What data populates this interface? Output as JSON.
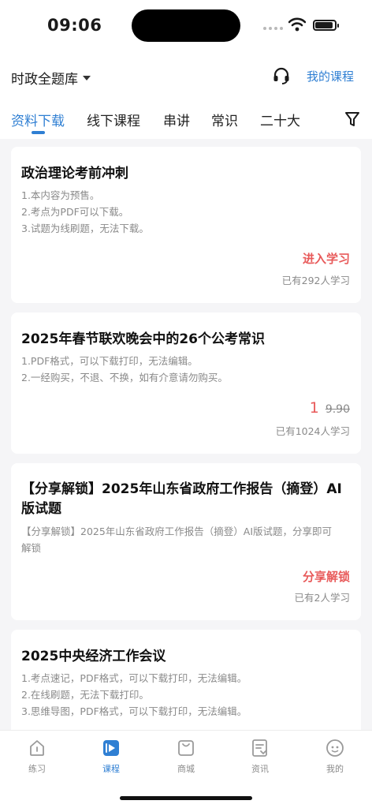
{
  "status_bar": {
    "time": "09:06"
  },
  "header": {
    "bank": "时政全题库",
    "my_course": "我的课程"
  },
  "tabs": [
    {
      "label": "资料下载",
      "active": true
    },
    {
      "label": "线下课程"
    },
    {
      "label": "串讲"
    },
    {
      "label": "常识"
    },
    {
      "label": "二十大"
    }
  ],
  "cards": [
    {
      "title": "政治理论考前冲刺",
      "lines": [
        "1.本内容为预售。",
        "2.考点为PDF可以下载。",
        "3.试题为线刷题，无法下载。"
      ],
      "action": "进入学习",
      "learners": "已有292人学习"
    },
    {
      "title": "2025年春节联欢晚会中的26个公考常识",
      "lines": [
        "1.PDF格式，可以下载打印，无法编辑。",
        "2.一经购买，不退、不换，如有介意请勿购买。"
      ],
      "price": "1",
      "old_price": "9.90",
      "learners": "已有1024人学习"
    },
    {
      "title_line1": "【分享解锁】2025年山东省政府工作报告（摘登）AI",
      "title_line2": "版试题",
      "line1": "【分享解锁】2025年山东省政府工作报告（摘登）AI版试题，分享即可",
      "line2": "解锁",
      "action": "分享解锁",
      "learners": "已有2人学习"
    },
    {
      "title": "2025中央经济工作会议",
      "lines": [
        "1.考点速记，PDF格式，可以下载打印，无法编辑。",
        "2.在线刷题，无法下载打印。",
        "3.思维导图，PDF格式，可以下载打印，无法编辑。"
      ]
    }
  ],
  "bottom_nav": [
    {
      "label": "练习",
      "icon": "practice-icon"
    },
    {
      "label": "课程",
      "icon": "course-icon",
      "active": true
    },
    {
      "label": "商城",
      "icon": "shop-icon"
    },
    {
      "label": "资讯",
      "icon": "news-icon"
    },
    {
      "label": "我的",
      "icon": "profile-icon"
    }
  ],
  "colors": {
    "accent": "#2f7fd3",
    "price": "#e85a5a",
    "muted": "#8a8a8a"
  }
}
